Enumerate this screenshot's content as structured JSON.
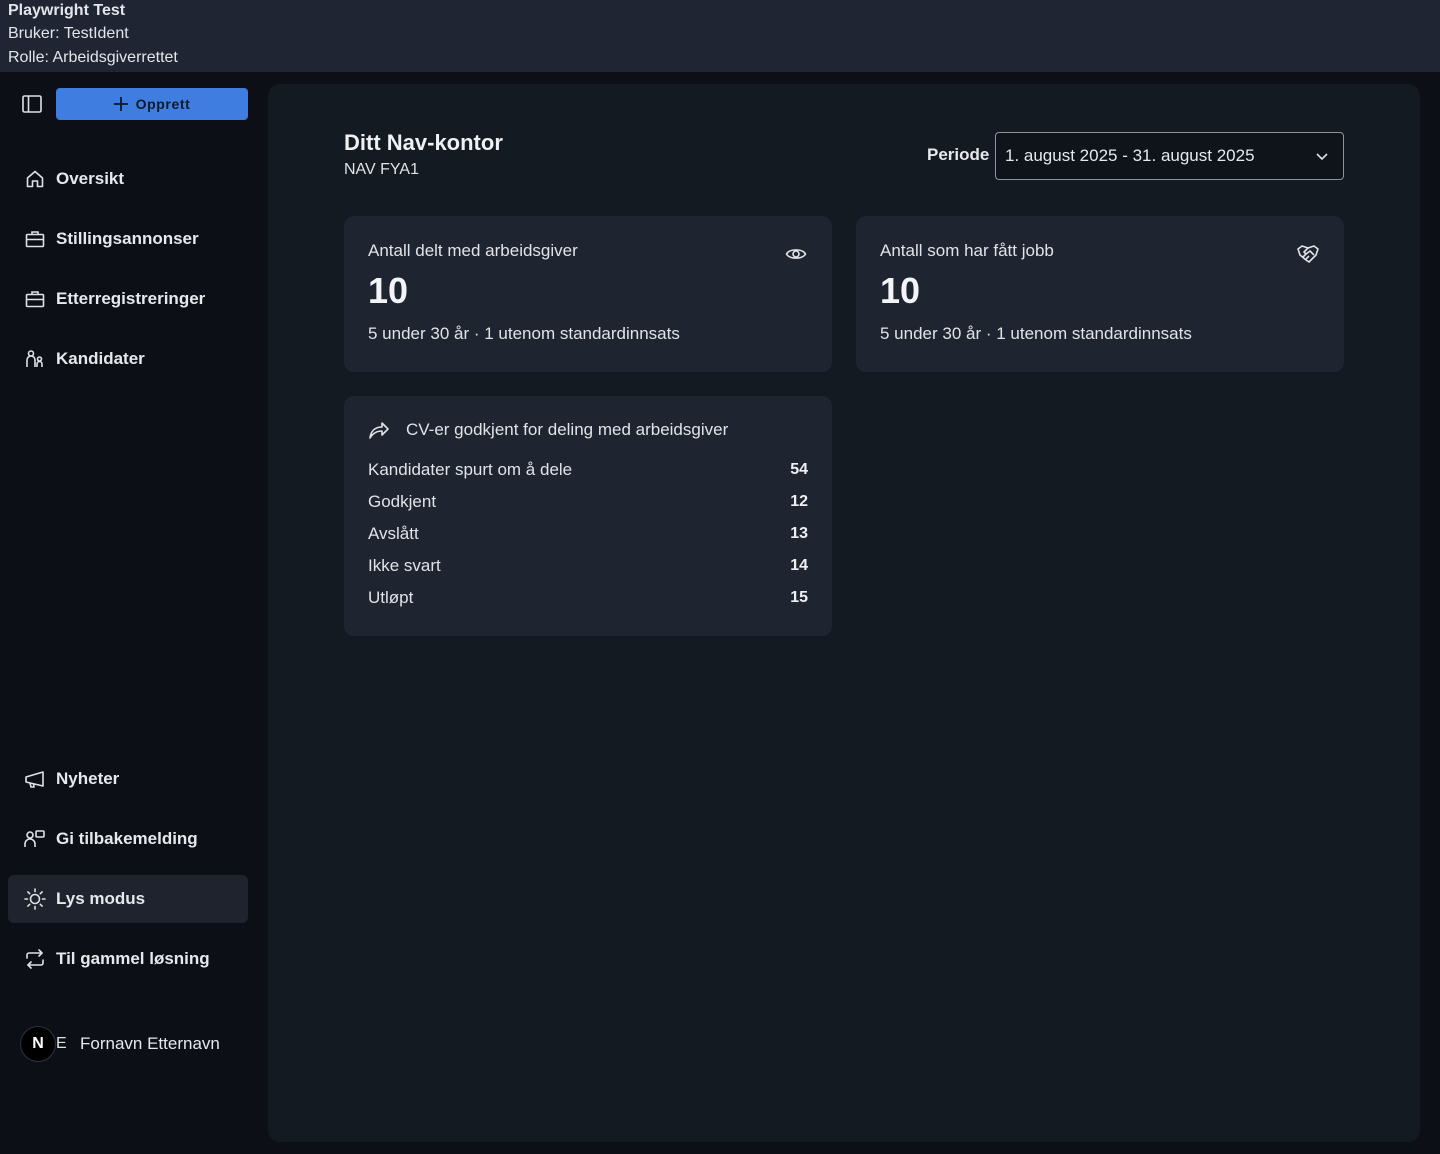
{
  "topbar": {
    "title": "Playwright Test",
    "user": "Bruker: TestIdent",
    "role": "Rolle: Arbeidsgiverrettet"
  },
  "sidebar": {
    "create_label": "Opprett",
    "items": [
      {
        "label": "Oversikt",
        "icon": "home-icon"
      },
      {
        "label": "Stillingsannonser",
        "icon": "briefcase-icon"
      },
      {
        "label": "Etterregistreringer",
        "icon": "briefcase-icon"
      },
      {
        "label": "Kandidater",
        "icon": "people-icon"
      }
    ],
    "bottom_items": [
      {
        "label": "Nyheter",
        "icon": "megaphone-icon"
      },
      {
        "label": "Gi tilbakemelding",
        "icon": "feedback-icon"
      },
      {
        "label": "Lys modus",
        "icon": "sun-icon",
        "active": true
      },
      {
        "label": "Til gammel løsning",
        "icon": "swap-icon"
      }
    ],
    "user": {
      "avatar_letter": "N",
      "avatar_overlap": "E",
      "name": "Fornavn Etternavn"
    }
  },
  "main": {
    "office_title": "Ditt Nav-kontor",
    "office_sub": "NAV FYA1",
    "period_label": "Periode",
    "period_value": "1. august 2025 - 31. august 2025",
    "cards": [
      {
        "label": "Antall delt med arbeidsgiver",
        "value": "10",
        "note": "5 under 30 år · 1 utenom standardinnsats",
        "icon": "eye-icon"
      },
      {
        "label": "Antall som har fått jobb",
        "value": "10",
        "note": "5 under 30 år · 1 utenom standardinnsats",
        "icon": "handshake-icon"
      }
    ],
    "cv_card": {
      "title": "CV-er godkjent for deling med arbeidsgiver",
      "rows": [
        {
          "label": "Kandidater spurt om å dele",
          "value": "54"
        },
        {
          "label": "Godkjent",
          "value": "12"
        },
        {
          "label": "Avslått",
          "value": "13"
        },
        {
          "label": "Ikke svart",
          "value": "14"
        },
        {
          "label": "Utløpt",
          "value": "15"
        }
      ]
    }
  },
  "colors": {
    "accent": "#3f7de0",
    "background": "#0c1016",
    "panel": "#141a22",
    "card": "#1e2430"
  }
}
